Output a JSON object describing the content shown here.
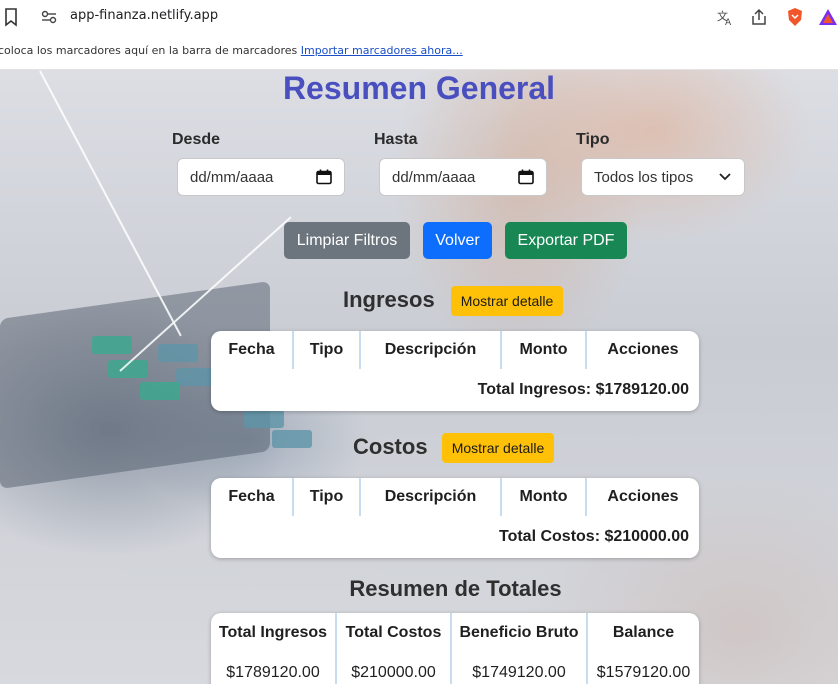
{
  "browser": {
    "url": "app-finanza.netlify.app",
    "bookmarks_text": "coloca los marcadores aquí en la barra de marcadores",
    "bookmarks_link": "Importar marcadores ahora..."
  },
  "page": {
    "title": "Resumen General",
    "filters": {
      "desde_label": "Desde",
      "desde_value": "dd/mm/aaaa",
      "hasta_label": "Hasta",
      "hasta_value": "dd/mm/aaaa",
      "tipo_label": "Tipo",
      "tipo_value": "Todos los tipos"
    },
    "buttons": {
      "clear": "Limpiar Filtros",
      "back": "Volver",
      "export": "Exportar PDF"
    },
    "ingresos": {
      "title": "Ingresos",
      "detail_button": "Mostrar detalle",
      "columns": [
        "Fecha",
        "Tipo",
        "Descripción",
        "Monto",
        "Acciones"
      ],
      "total": "Total Ingresos: $1789120.00"
    },
    "costos": {
      "title": "Costos",
      "detail_button": "Mostrar detalle",
      "columns": [
        "Fecha",
        "Tipo",
        "Descripción",
        "Monto",
        "Acciones"
      ],
      "total": "Total Costos: $210000.00"
    },
    "resumen": {
      "title": "Resumen de Totales",
      "columns": [
        "Total Ingresos",
        "Total Costos",
        "Beneficio Bruto",
        "Balance"
      ],
      "values": [
        "$1789120.00",
        "$210000.00",
        "$1749120.00",
        "$1579120.00"
      ]
    }
  },
  "colors": {
    "title": "#4a4fc0",
    "btn_gray": "#6c757d",
    "btn_blue": "#0d6efd",
    "btn_green": "#198754",
    "detail_yellow": "#ffc107"
  },
  "icons": [
    "bookmark-icon",
    "site-settings-icon",
    "translate-icon",
    "share-icon",
    "brave-shield-icon",
    "brave-rewards-icon",
    "calendar-icon",
    "chevron-down-icon"
  ]
}
